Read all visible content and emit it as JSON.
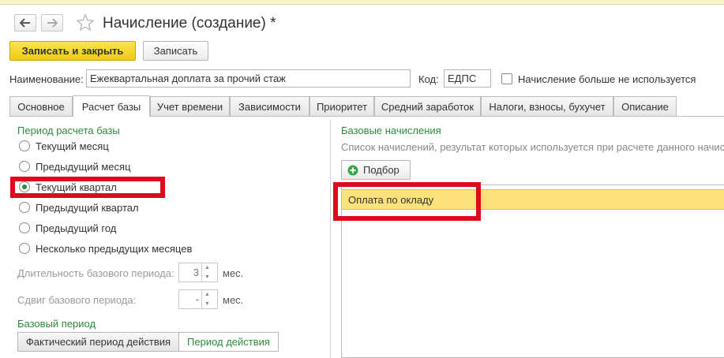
{
  "window": {
    "title": "Начисление (создание) *",
    "back_icon": "arrow-left-icon",
    "forward_icon": "arrow-right-icon",
    "favorite_icon": "star-icon"
  },
  "toolbar": {
    "save_close_label": "Записать и закрыть",
    "save_label": "Записать"
  },
  "header": {
    "name_label": "Наименование:",
    "name_value": "Ежеквартальная доплата за прочий стаж",
    "code_label": "Код:",
    "code_value": "ЕДПС",
    "unused_label": "Начисление больше не используется",
    "unused_checked": false
  },
  "tabs": [
    {
      "label": "Основное",
      "active": false
    },
    {
      "label": "Расчет базы",
      "active": true
    },
    {
      "label": "Учет времени",
      "active": false
    },
    {
      "label": "Зависимости",
      "active": false
    },
    {
      "label": "Приоритет",
      "active": false
    },
    {
      "label": "Средний заработок",
      "active": false
    },
    {
      "label": "Налоги, взносы, бухучет",
      "active": false
    },
    {
      "label": "Описание",
      "active": false
    }
  ],
  "period_section": {
    "title": "Период расчета базы",
    "options": [
      {
        "label": "Текущий месяц",
        "selected": false
      },
      {
        "label": "Предыдущий месяц",
        "selected": false
      },
      {
        "label": "Текущий квартал",
        "selected": true
      },
      {
        "label": "Предыдущий квартал",
        "selected": false
      },
      {
        "label": "Предыдущий год",
        "selected": false
      },
      {
        "label": "Несколько предыдущих месяцев",
        "selected": false
      }
    ],
    "duration_label": "Длительность базового периода:",
    "duration_value": "3",
    "duration_unit": "мес.",
    "shift_label": "Сдвиг базового периода:",
    "shift_value": "-",
    "shift_unit": "мес."
  },
  "base_period": {
    "title": "Базовый период",
    "actual_label": "Фактический период действия",
    "action_label": "Период действия"
  },
  "base_accruals": {
    "title": "Базовые начисления",
    "description": "Список начислений, результат которых используется при расчете данного начис",
    "pick_label": "Подбор",
    "pick_icon": "add-circle-icon",
    "rows": [
      "Оплата по окладу"
    ]
  },
  "colors": {
    "accent_green": "#2e8b3a",
    "primary_button": "#f2d21e",
    "highlight_red": "#e0081c",
    "selected_row": "#fbe27a"
  }
}
